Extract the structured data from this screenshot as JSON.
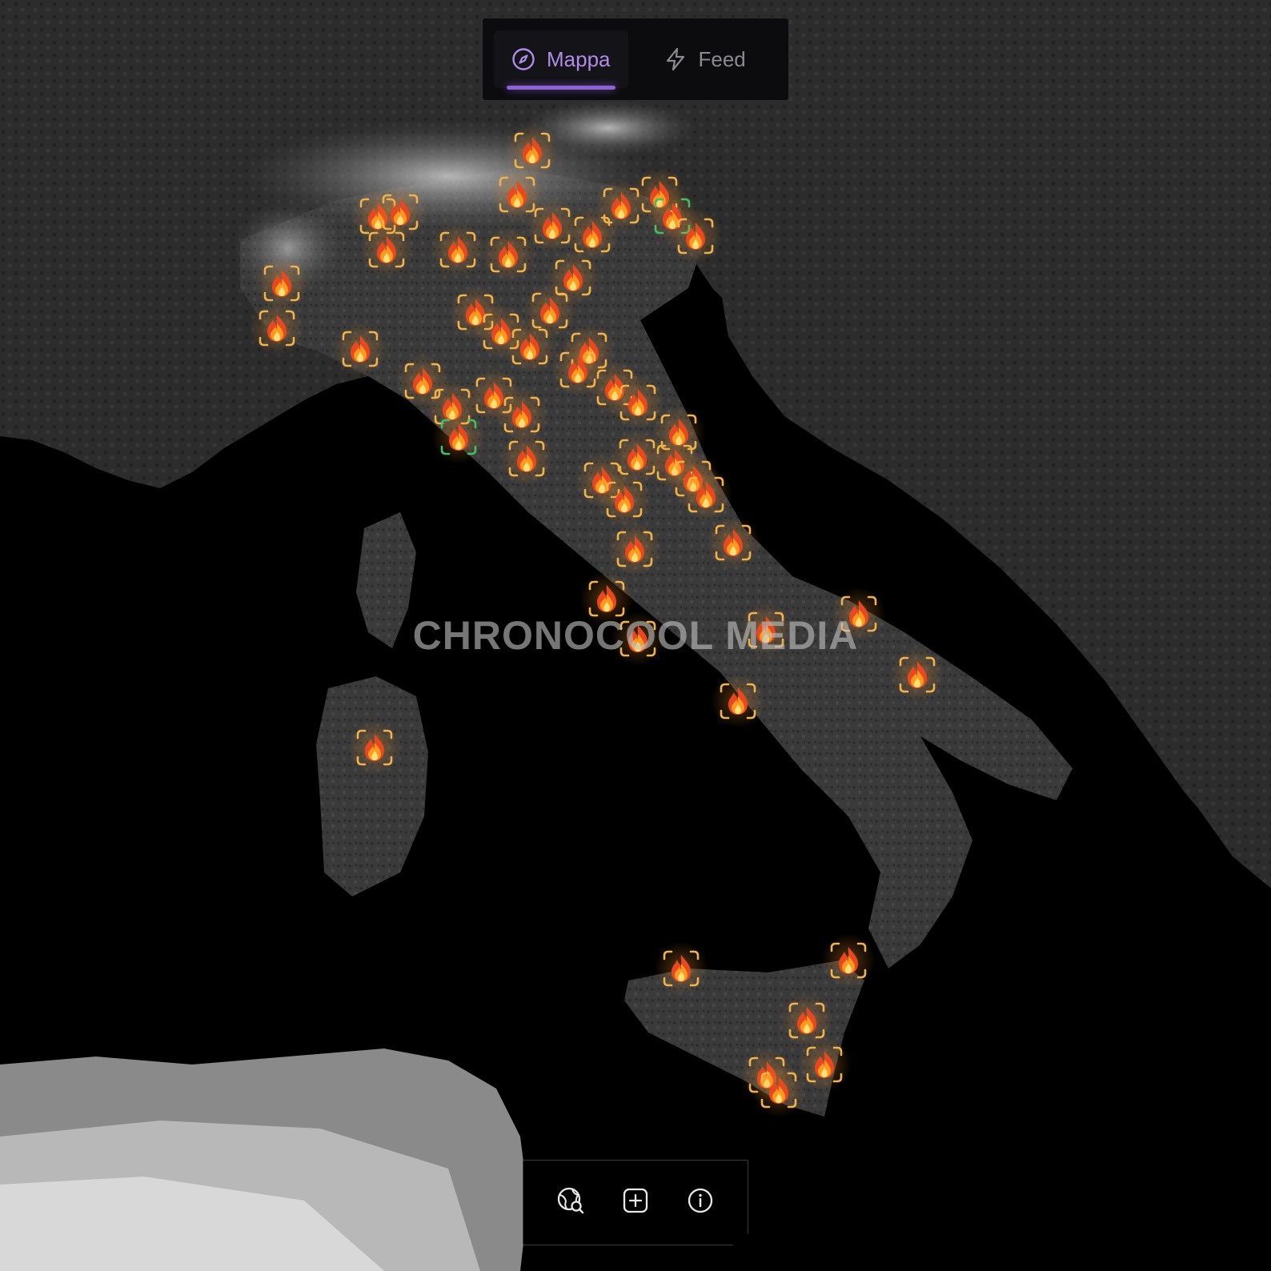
{
  "tabs": [
    {
      "label": "Mappa",
      "icon": "compass-icon",
      "active": true
    },
    {
      "label": "Feed",
      "icon": "lightning-icon",
      "active": false
    }
  ],
  "watermark": "CHRONOCOOL MEDIA",
  "toolbar": {
    "buttons": [
      {
        "icon": "globe-search-icon"
      },
      {
        "icon": "plus-square-icon"
      },
      {
        "icon": "info-icon"
      }
    ]
  },
  "marker_icon": "fire-icon",
  "colors": {
    "accent": "#9b6fe0",
    "marker_bracket": "#f0b24a",
    "marker_bracket_selected": "#3fbf6a",
    "sea": "#000000",
    "land": "#3c3c3c"
  }
}
